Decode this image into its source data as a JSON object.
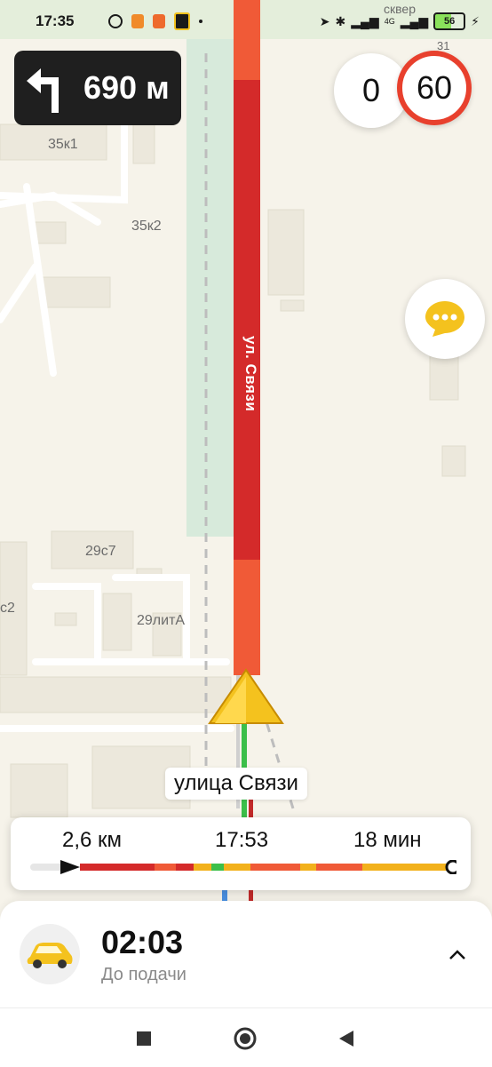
{
  "status_bar": {
    "time": "17:35",
    "battery": "56",
    "network": "4G"
  },
  "navigation": {
    "turn_distance": "690 м",
    "turn_icon": "turn-left-arrow"
  },
  "speed": {
    "current": "0",
    "limit": "60"
  },
  "map": {
    "street_name_on_map": "ул. Связи",
    "labels": [
      "сквер",
      "31",
      "35к1",
      "35к2",
      "29с7",
      "29литА",
      "с2"
    ],
    "current_street": "улица Связи",
    "route_colors": {
      "heavy": "#d42a2a",
      "medium": "#f05a37",
      "slow": "#f2b11c",
      "free": "#3cbf4a"
    }
  },
  "route": {
    "distance": "2,6 км",
    "arrival": "17:53",
    "duration": "18 мин",
    "progress_fraction": 0.12
  },
  "bottom_sheet": {
    "eta": "02:03",
    "caption": "До подачи"
  },
  "nav_bar": {
    "icons": [
      "recent-apps-icon",
      "home-icon",
      "back-icon"
    ]
  }
}
